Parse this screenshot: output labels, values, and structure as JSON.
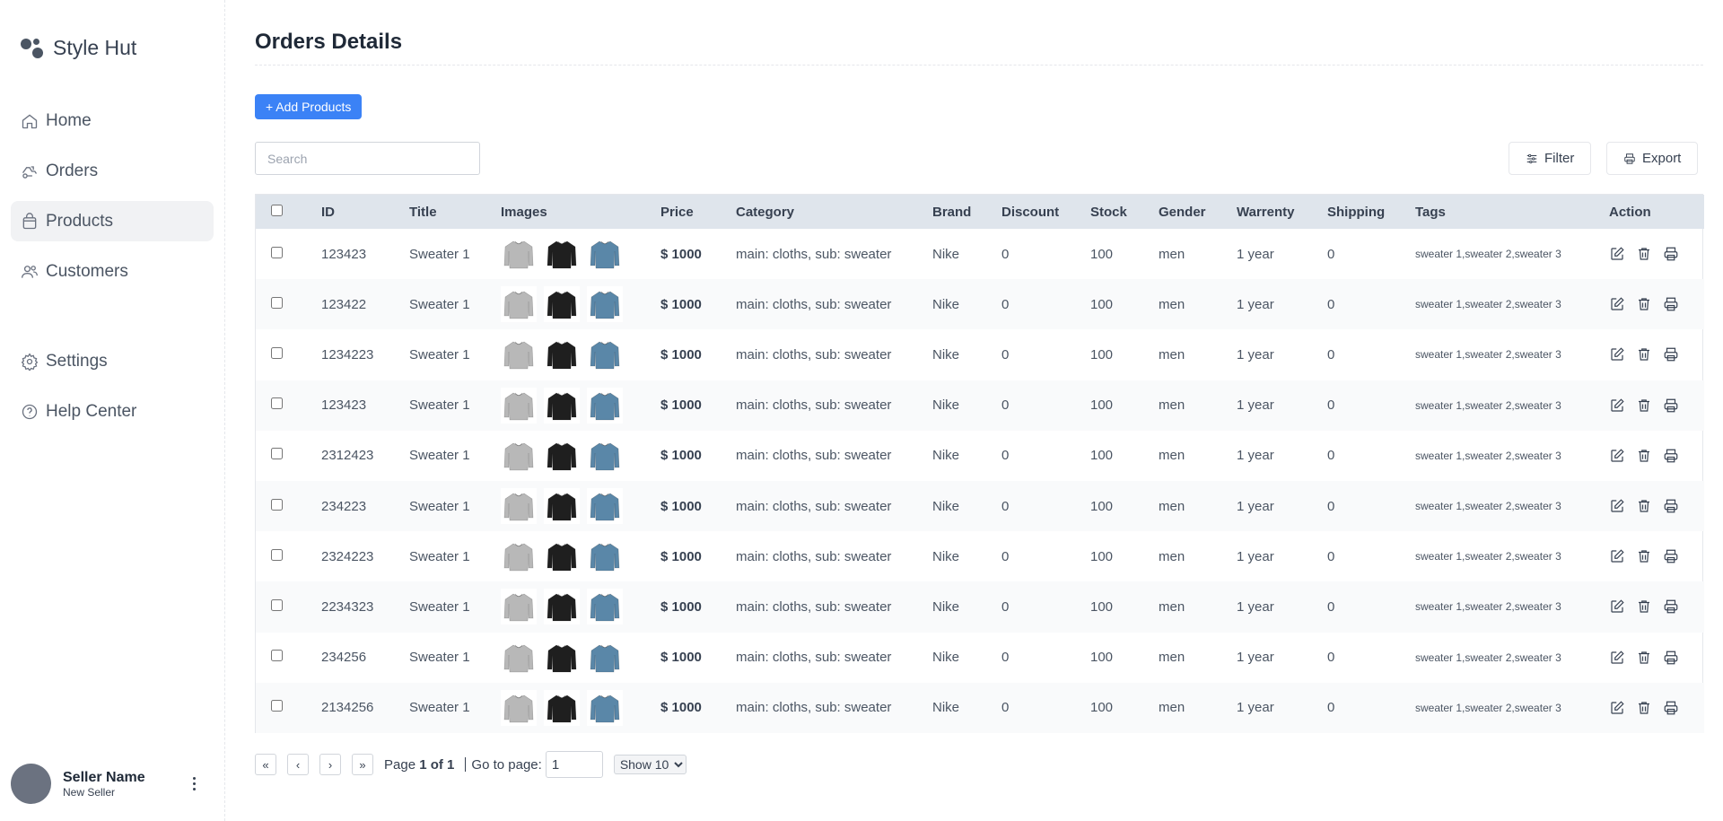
{
  "brand": {
    "name": "Style Hut"
  },
  "sidebar": {
    "items": [
      {
        "label": "Home",
        "icon": "home-icon"
      },
      {
        "label": "Orders",
        "icon": "delivery-icon"
      },
      {
        "label": "Products",
        "icon": "bag-icon",
        "active": true
      },
      {
        "label": "Customers",
        "icon": "users-icon"
      }
    ],
    "secondary": [
      {
        "label": "Settings",
        "icon": "gear-icon"
      },
      {
        "label": "Help Center",
        "icon": "help-icon"
      }
    ]
  },
  "profile": {
    "name": "Seller Name",
    "role": "New Seller"
  },
  "page": {
    "title": "Orders Details"
  },
  "toolbar": {
    "add_label": "+ Add Products",
    "search_placeholder": "Search",
    "filter_label": "Filter",
    "export_label": "Export"
  },
  "table": {
    "columns": [
      "ID",
      "Title",
      "Images",
      "Price",
      "Category",
      "Brand",
      "Discount",
      "Stock",
      "Gender",
      "Warrenty",
      "Shipping",
      "Tags",
      "Action"
    ],
    "rows": [
      {
        "id": "123423",
        "title": "Sweater 1",
        "price": "$ 1000",
        "category": "main: cloths,  sub: sweater",
        "brand": "Nike",
        "discount": "0",
        "stock": "100",
        "gender": "men",
        "warrenty": "1 year",
        "shipping": "0",
        "tags": "sweater 1,sweater 2,sweater 3"
      },
      {
        "id": "123422",
        "title": "Sweater 1",
        "price": "$ 1000",
        "category": "main: cloths,  sub: sweater",
        "brand": "Nike",
        "discount": "0",
        "stock": "100",
        "gender": "men",
        "warrenty": "1 year",
        "shipping": "0",
        "tags": "sweater 1,sweater 2,sweater 3"
      },
      {
        "id": "1234223",
        "title": "Sweater 1",
        "price": "$ 1000",
        "category": "main: cloths,  sub: sweater",
        "brand": "Nike",
        "discount": "0",
        "stock": "100",
        "gender": "men",
        "warrenty": "1 year",
        "shipping": "0",
        "tags": "sweater 1,sweater 2,sweater 3"
      },
      {
        "id": "123423",
        "title": "Sweater 1",
        "price": "$ 1000",
        "category": "main: cloths,  sub: sweater",
        "brand": "Nike",
        "discount": "0",
        "stock": "100",
        "gender": "men",
        "warrenty": "1 year",
        "shipping": "0",
        "tags": "sweater 1,sweater 2,sweater 3"
      },
      {
        "id": "2312423",
        "title": "Sweater 1",
        "price": "$ 1000",
        "category": "main: cloths,  sub: sweater",
        "brand": "Nike",
        "discount": "0",
        "stock": "100",
        "gender": "men",
        "warrenty": "1 year",
        "shipping": "0",
        "tags": "sweater 1,sweater 2,sweater 3"
      },
      {
        "id": "234223",
        "title": "Sweater 1",
        "price": "$ 1000",
        "category": "main: cloths,  sub: sweater",
        "brand": "Nike",
        "discount": "0",
        "stock": "100",
        "gender": "men",
        "warrenty": "1 year",
        "shipping": "0",
        "tags": "sweater 1,sweater 2,sweater 3"
      },
      {
        "id": "2324223",
        "title": "Sweater 1",
        "price": "$ 1000",
        "category": "main: cloths,  sub: sweater",
        "brand": "Nike",
        "discount": "0",
        "stock": "100",
        "gender": "men",
        "warrenty": "1 year",
        "shipping": "0",
        "tags": "sweater 1,sweater 2,sweater 3"
      },
      {
        "id": "2234323",
        "title": "Sweater 1",
        "price": "$ 1000",
        "category": "main: cloths,  sub: sweater",
        "brand": "Nike",
        "discount": "0",
        "stock": "100",
        "gender": "men",
        "warrenty": "1 year",
        "shipping": "0",
        "tags": "sweater 1,sweater 2,sweater 3"
      },
      {
        "id": "234256",
        "title": "Sweater 1",
        "price": "$ 1000",
        "category": "main: cloths,  sub: sweater",
        "brand": "Nike",
        "discount": "0",
        "stock": "100",
        "gender": "men",
        "warrenty": "1 year",
        "shipping": "0",
        "tags": "sweater 1,sweater 2,sweater 3"
      },
      {
        "id": "2134256",
        "title": "Sweater 1",
        "price": "$ 1000",
        "category": "main: cloths,  sub: sweater",
        "brand": "Nike",
        "discount": "0",
        "stock": "100",
        "gender": "men",
        "warrenty": "1 year",
        "shipping": "0",
        "tags": "sweater 1,sweater 2,sweater 3"
      }
    ],
    "thumb_colors": {
      "grey": "#b8b8b8",
      "black": "#1f1f1f",
      "blue": "#5a87a8"
    }
  },
  "pagination": {
    "page_prefix": "Page",
    "page_status": "1 of 1",
    "goto_label": "Go to page:",
    "goto_value": "1",
    "show_label": "Show 10",
    "first": "«",
    "prev": "‹",
    "next": "›",
    "last": "»"
  },
  "colors": {
    "accent": "#3b82f6",
    "header_bg": "#dfe5ec",
    "active_nav": "#f1f2f4"
  }
}
